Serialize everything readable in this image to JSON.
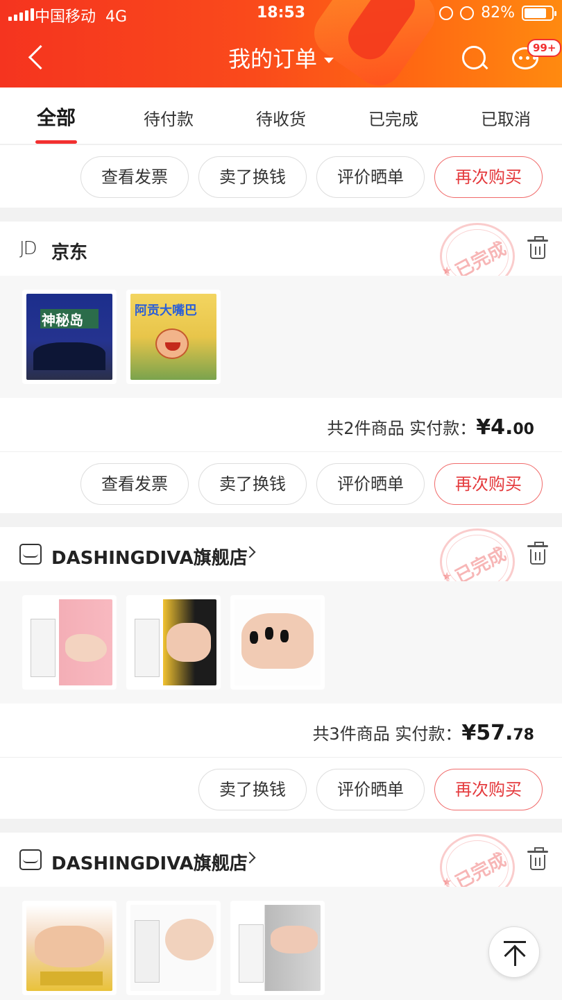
{
  "status_bar": {
    "carrier": "中国移动",
    "network": "4G",
    "time": "18:53",
    "battery": "82%",
    "battery_level": 0.82
  },
  "header": {
    "title": "我的订单",
    "message_badge": "99+"
  },
  "tabs": [
    {
      "label": "全部",
      "active": true
    },
    {
      "label": "待付款",
      "active": false
    },
    {
      "label": "待收货",
      "active": false
    },
    {
      "label": "已完成",
      "active": false
    },
    {
      "label": "已取消",
      "active": false
    }
  ],
  "top_actions": [
    "查看发票",
    "卖了换钱",
    "评价晒单",
    "再次购买"
  ],
  "orders": [
    {
      "shop": "京东",
      "shop_logo": "JD",
      "stamp": "已完成",
      "product_images": [
        {
          "label": "神秘岛"
        },
        {
          "label": "阿贡大嘴巴"
        }
      ],
      "summary_prefix": "共2件商品 实付款：",
      "price_main": "¥4.",
      "price_decimal": "00",
      "actions": [
        "查看发票",
        "卖了换钱",
        "评价晒单",
        "再次购买"
      ]
    },
    {
      "shop": "DASHINGDIVA旗舰店",
      "stamp": "已完成",
      "summary_prefix": "共3件商品 实付款：",
      "price_main": "¥57.",
      "price_decimal": "78",
      "actions": [
        "卖了换钱",
        "评价晒单",
        "再次购买"
      ]
    },
    {
      "shop": "DASHINGDIVA旗舰店",
      "stamp": "已完成"
    }
  ]
}
